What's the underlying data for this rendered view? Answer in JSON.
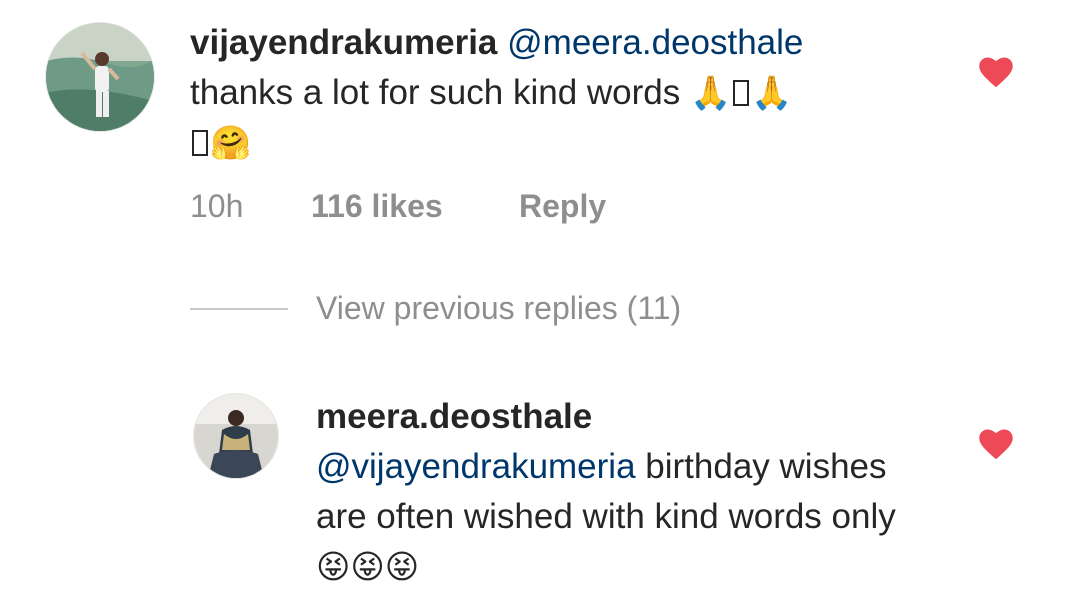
{
  "comment1": {
    "username": "vijayendrakumeria",
    "mention": "@meera.deosthale",
    "text": "thanks a lot for such kind words",
    "emojis_line1_a": "🙏",
    "emojis_line1_b": "🙏",
    "emoji_line2": "🤗",
    "time": "10h",
    "likes": "116 likes",
    "reply": "Reply",
    "liked": true
  },
  "view_previous": "View previous replies (11)",
  "comment2": {
    "username": "meera.deosthale",
    "mention": "@vijayendrakumeria",
    "text": "birthday wishes are often wished with kind words only",
    "emojis": "😝😝😝",
    "liked": true
  },
  "colors": {
    "heart": "#ed4956",
    "mention": "#00376b",
    "meta": "#8e8e8e"
  },
  "icons": {
    "like": "heart-icon"
  }
}
